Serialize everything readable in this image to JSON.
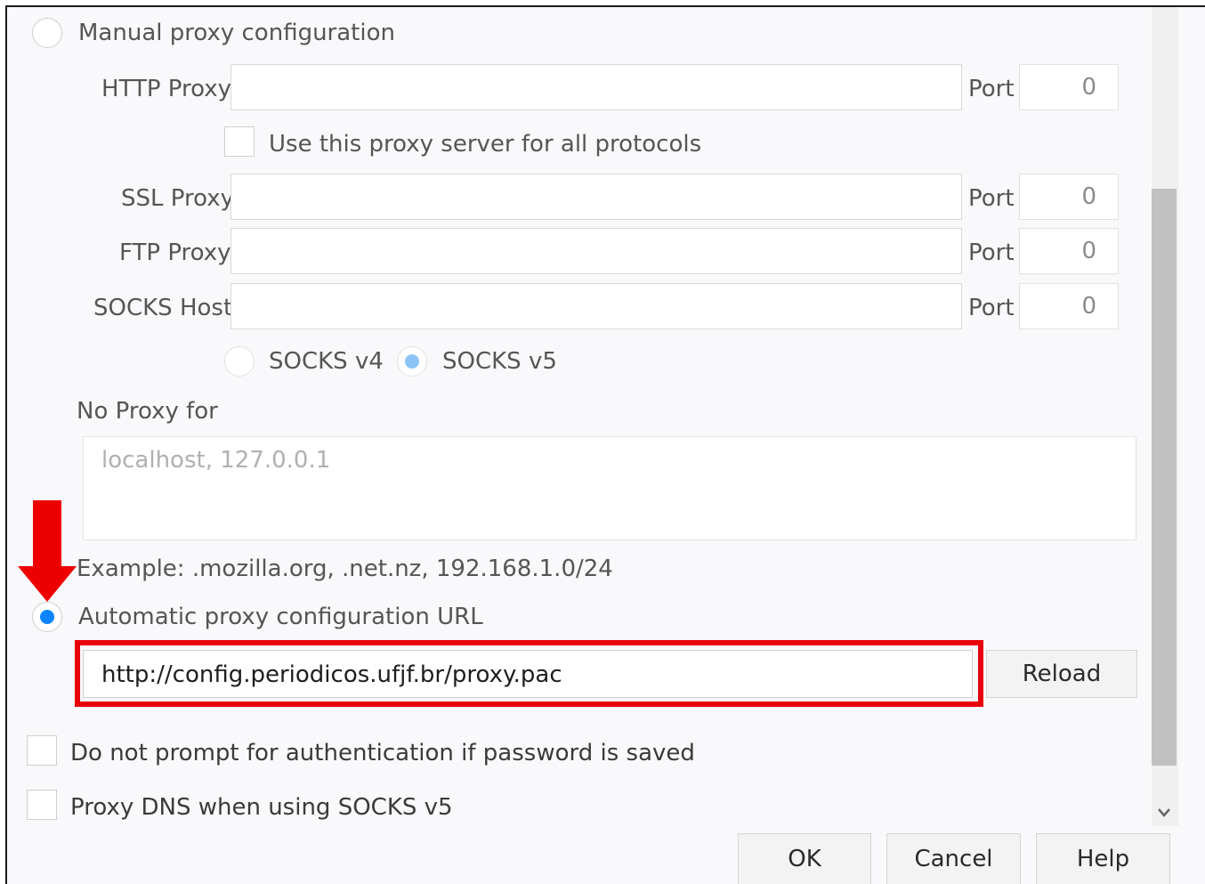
{
  "manual": {
    "label": "Manual proxy configuration"
  },
  "http": {
    "label": "HTTP Proxy",
    "value": "",
    "port_label": "Port",
    "port_value": "0"
  },
  "use_all": {
    "label": "Use this proxy server for all protocols"
  },
  "ssl": {
    "label": "SSL Proxy",
    "value": "",
    "port_label": "Port",
    "port_value": "0"
  },
  "ftp": {
    "label": "FTP Proxy",
    "value": "",
    "port_label": "Port",
    "port_value": "0"
  },
  "socks": {
    "label": "SOCKS Host",
    "value": "",
    "port_label": "Port",
    "port_value": "0",
    "v4_label": "SOCKS v4",
    "v5_label": "SOCKS v5"
  },
  "no_proxy": {
    "label": "No Proxy for",
    "placeholder": "localhost, 127.0.0.1",
    "example": "Example: .mozilla.org, .net.nz, 192.168.1.0/24"
  },
  "auto": {
    "label": "Automatic proxy configuration URL",
    "url": "http://config.periodicos.ufjf.br/proxy.pac",
    "reload_label": "Reload"
  },
  "no_prompt": {
    "label": "Do not prompt for authentication if password is saved"
  },
  "proxy_dns": {
    "label": "Proxy DNS when using SOCKS v5"
  },
  "buttons": {
    "ok": "OK",
    "cancel": "Cancel",
    "help": "Help"
  },
  "colors": {
    "accent": "#0a84ff",
    "highlight": "#e8000b",
    "arrow": "#ee0000"
  }
}
